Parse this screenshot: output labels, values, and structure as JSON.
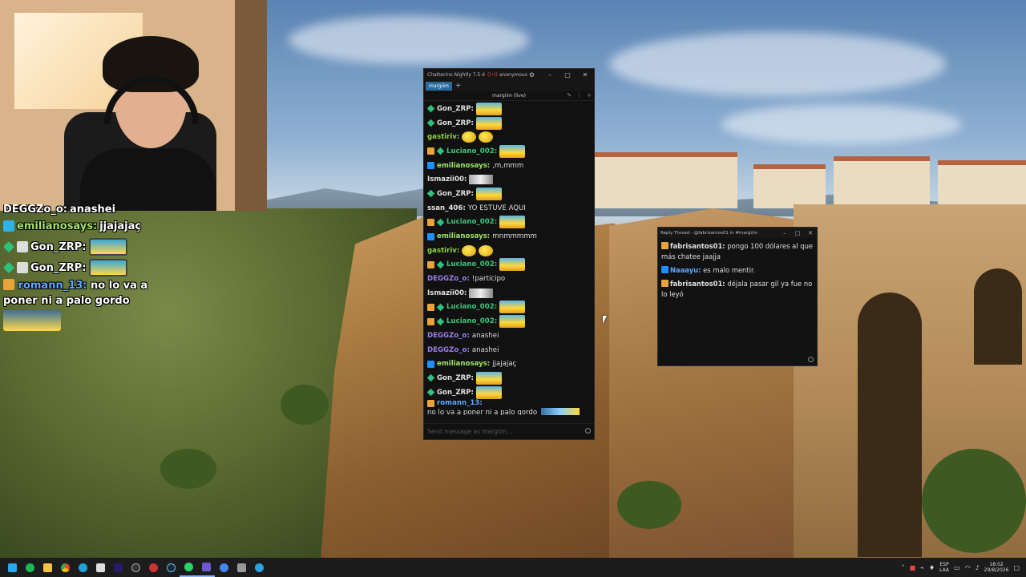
{
  "overlay_chat": {
    "messages": [
      {
        "user": "DEGGZo_o:",
        "text": "anashei",
        "user_color": "#e8e8e8"
      },
      {
        "user": "emilianosays:",
        "text": "jjajajaç",
        "user_color": "#a5e36b"
      },
      {
        "user": "Gon_ZRP:",
        "text": "",
        "user_color": "#e8e8e8"
      },
      {
        "user": "Gon_ZRP:",
        "text": "",
        "user_color": "#e8e8e8"
      },
      {
        "user": "romann_13:",
        "text": "no lo va a poner ni a palo gordo",
        "user_color": "#5fa8ff"
      }
    ]
  },
  "chatterino": {
    "title": "Chatterino Nightly 7.5.4",
    "user": "anonymous",
    "tab_label": "margiim",
    "tab_add": "+",
    "channel_label": "margiim (live)",
    "input_placeholder": "Send message as margiim...",
    "window_controls": {
      "minimize": "–",
      "maximize": "□",
      "close": "✕"
    },
    "messages": [
      {
        "badges": [
          "vip"
        ],
        "user": "Gon_ZRP:",
        "color": "#e0e0e0",
        "text": "",
        "emote": "big"
      },
      {
        "badges": [
          "vip"
        ],
        "user": "Gon_ZRP:",
        "color": "#e0e0e0",
        "text": "",
        "emote": "big"
      },
      {
        "badges": [],
        "user": "gastiriv:",
        "color": "#8fd33f",
        "text": "",
        "emote": "small"
      },
      {
        "badges": [
          "sub",
          "vip"
        ],
        "user": "Luciano_002:",
        "color": "#3fc47b",
        "text": "",
        "emote": "big"
      },
      {
        "badges": [
          "prime"
        ],
        "user": "emilianosays:",
        "color": "#9fe36b",
        "text": ",m,mmm",
        "emote": ""
      },
      {
        "badges": [],
        "user": "Ismazii00:",
        "color": "#e0e0e0",
        "text": "",
        "emote": "photo"
      },
      {
        "badges": [
          "vip"
        ],
        "user": "Gon_ZRP:",
        "color": "#e0e0e0",
        "text": "",
        "emote": "big"
      },
      {
        "badges": [],
        "user": "ssan_406:",
        "color": "#e0e0e0",
        "text": "YO ESTUVE AQUI",
        "emote": ""
      },
      {
        "badges": [
          "sub",
          "vip"
        ],
        "user": "Luciano_002:",
        "color": "#3fc47b",
        "text": "",
        "emote": "big"
      },
      {
        "badges": [
          "prime"
        ],
        "user": "emilianosays:",
        "color": "#9fe36b",
        "text": "mnmmmmm",
        "emote": ""
      },
      {
        "badges": [],
        "user": "gastiriv:",
        "color": "#8fd33f",
        "text": "",
        "emote": "small"
      },
      {
        "badges": [
          "sub",
          "vip"
        ],
        "user": "Luciano_002:",
        "color": "#3fc47b",
        "text": "",
        "emote": "big"
      },
      {
        "badges": [],
        "user": "DEGGZo_o:",
        "color": "#9a7fe8",
        "text": "!participo",
        "emote": ""
      },
      {
        "badges": [],
        "user": "Ismazii00:",
        "color": "#e0e0e0",
        "text": "",
        "emote": "photo"
      },
      {
        "badges": [
          "sub",
          "vip"
        ],
        "user": "Luciano_002:",
        "color": "#3fc47b",
        "text": "",
        "emote": "big"
      },
      {
        "badges": [
          "sub",
          "vip"
        ],
        "user": "Luciano_002:",
        "color": "#3fc47b",
        "text": "",
        "emote": "big"
      },
      {
        "badges": [],
        "user": "DEGGZo_o:",
        "color": "#9a7fe8",
        "text": "anashei",
        "emote": ""
      },
      {
        "badges": [],
        "user": "DEGGZo_o:",
        "color": "#9a7fe8",
        "text": "anashei",
        "emote": ""
      },
      {
        "badges": [
          "prime"
        ],
        "user": "emilianosays:",
        "color": "#9fe36b",
        "text": "jjajajaç",
        "emote": ""
      },
      {
        "badges": [
          "vip"
        ],
        "user": "Gon_ZRP:",
        "color": "#e0e0e0",
        "text": "",
        "emote": "big"
      },
      {
        "badges": [
          "vip"
        ],
        "user": "Gon_ZRP:",
        "color": "#e0e0e0",
        "text": "",
        "emote": "big"
      },
      {
        "badges": [
          "sub"
        ],
        "user": "romann_13:",
        "color": "#5fa8ff",
        "text": "no lo va a poner ni a palo gordo",
        "emote": "wide"
      }
    ]
  },
  "reply_thread": {
    "title": "Reply Thread - @fabrisantos01 in #margiim",
    "messages": [
      {
        "badge": "sub",
        "user": "fabrisantos01:",
        "color": "#e0e0e0",
        "text": "pongo 100 dólares al que más chatee jaajja"
      },
      {
        "badge": "prime",
        "user": "Naaayu:",
        "color": "#5fa8ff",
        "text": "es malo mentir."
      },
      {
        "badge": "sub",
        "user": "fabrisantos01:",
        "color": "#e0e0e0",
        "text": "déjala pasar gil ya fue no lo leyó"
      }
    ]
  },
  "taskbar": {
    "language": "ESP",
    "layout": "LAA",
    "time": "18:02",
    "date": "29/8/2026",
    "apps": [
      "windows-start",
      "spotify",
      "file-explorer",
      "chrome",
      "edge",
      "notes",
      "premiere",
      "obs",
      "gear",
      "steam",
      "whatsapp",
      "chatterino",
      "chrome-alt",
      "arrow-app",
      "telegram"
    ]
  }
}
